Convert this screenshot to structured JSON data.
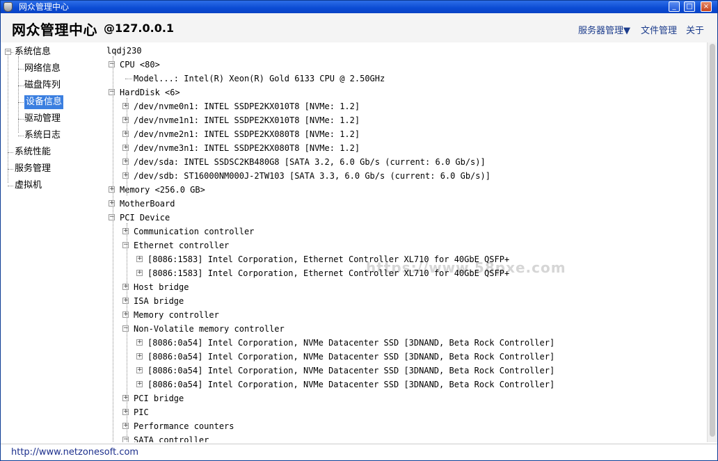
{
  "window": {
    "title": "网众管理中心"
  },
  "header": {
    "app_name": "网众管理中心",
    "host": "@127.0.0.1",
    "menu": [
      "服务器管理▼",
      "文件管理",
      "关于"
    ]
  },
  "sidebar": {
    "items": [
      {
        "label": "系统信息",
        "level": 0
      },
      {
        "label": "网络信息",
        "level": 1
      },
      {
        "label": "磁盘阵列",
        "level": 1
      },
      {
        "label": "设备信息",
        "level": 1,
        "selected": true
      },
      {
        "label": "驱动管理",
        "level": 1
      },
      {
        "label": "系统日志",
        "level": 1
      },
      {
        "label": "系统性能",
        "level": 0
      },
      {
        "label": "服务管理",
        "level": 0
      },
      {
        "label": "虚拟机",
        "level": 0
      }
    ]
  },
  "tree": [
    {
      "text": "lqdj230",
      "level": 0,
      "exp": ""
    },
    {
      "text": "CPU <80>",
      "level": 1,
      "exp": "-"
    },
    {
      "text": "Model...: Intel(R) Xeon(R) Gold 6133 CPU @ 2.50GHz",
      "level": 2,
      "exp": ""
    },
    {
      "text": "HardDisk <6>",
      "level": 1,
      "exp": "-"
    },
    {
      "text": "/dev/nvme0n1: INTEL SSDPE2KX010T8 [NVMe: 1.2]",
      "level": 2,
      "exp": "+"
    },
    {
      "text": "/dev/nvme1n1: INTEL SSDPE2KX010T8 [NVMe: 1.2]",
      "level": 2,
      "exp": "+"
    },
    {
      "text": "/dev/nvme2n1: INTEL SSDPE2KX080T8 [NVMe: 1.2]",
      "level": 2,
      "exp": "+"
    },
    {
      "text": "/dev/nvme3n1: INTEL SSDPE2KX080T8 [NVMe: 1.2]",
      "level": 2,
      "exp": "+"
    },
    {
      "text": "/dev/sda: INTEL SSDSC2KB480G8 [SATA 3.2, 6.0 Gb/s (current: 6.0 Gb/s)]",
      "level": 2,
      "exp": "+"
    },
    {
      "text": "/dev/sdb: ST16000NM000J-2TW103 [SATA 3.3, 6.0 Gb/s (current: 6.0 Gb/s)]",
      "level": 2,
      "exp": "+"
    },
    {
      "text": "Memory <256.0 GB>",
      "level": 1,
      "exp": "+"
    },
    {
      "text": "MotherBoard",
      "level": 1,
      "exp": "+"
    },
    {
      "text": "PCI Device",
      "level": 1,
      "exp": "-"
    },
    {
      "text": "Communication controller",
      "level": 2,
      "exp": "+"
    },
    {
      "text": "Ethernet controller",
      "level": 2,
      "exp": "-"
    },
    {
      "text": "[8086:1583] Intel Corporation, Ethernet Controller XL710 for 40GbE QSFP+",
      "level": 3,
      "exp": "+"
    },
    {
      "text": "[8086:1583] Intel Corporation, Ethernet Controller XL710 for 40GbE QSFP+",
      "level": 3,
      "exp": "+"
    },
    {
      "text": "Host bridge",
      "level": 2,
      "exp": "+"
    },
    {
      "text": "ISA bridge",
      "level": 2,
      "exp": "+"
    },
    {
      "text": "Memory controller",
      "level": 2,
      "exp": "+"
    },
    {
      "text": "Non-Volatile memory controller",
      "level": 2,
      "exp": "-"
    },
    {
      "text": "[8086:0a54] Intel Corporation, NVMe Datacenter SSD [3DNAND, Beta Rock Controller]",
      "level": 3,
      "exp": "+"
    },
    {
      "text": "[8086:0a54] Intel Corporation, NVMe Datacenter SSD [3DNAND, Beta Rock Controller]",
      "level": 3,
      "exp": "+"
    },
    {
      "text": "[8086:0a54] Intel Corporation, NVMe Datacenter SSD [3DNAND, Beta Rock Controller]",
      "level": 3,
      "exp": "+"
    },
    {
      "text": "[8086:0a54] Intel Corporation, NVMe Datacenter SSD [3DNAND, Beta Rock Controller]",
      "level": 3,
      "exp": "+"
    },
    {
      "text": "PCI bridge",
      "level": 2,
      "exp": "+"
    },
    {
      "text": "PIC",
      "level": 2,
      "exp": "+"
    },
    {
      "text": "Performance counters",
      "level": 2,
      "exp": "+"
    },
    {
      "text": "SATA controller",
      "level": 2,
      "exp": "-"
    }
  ],
  "status": {
    "link": "http://www.netzonesoft.com"
  },
  "watermark": "https://www.58pxe.com",
  "colors": {
    "titlebar": "#0b4bd3",
    "selected": "#3b7fe0",
    "link": "#1c2f8c"
  }
}
